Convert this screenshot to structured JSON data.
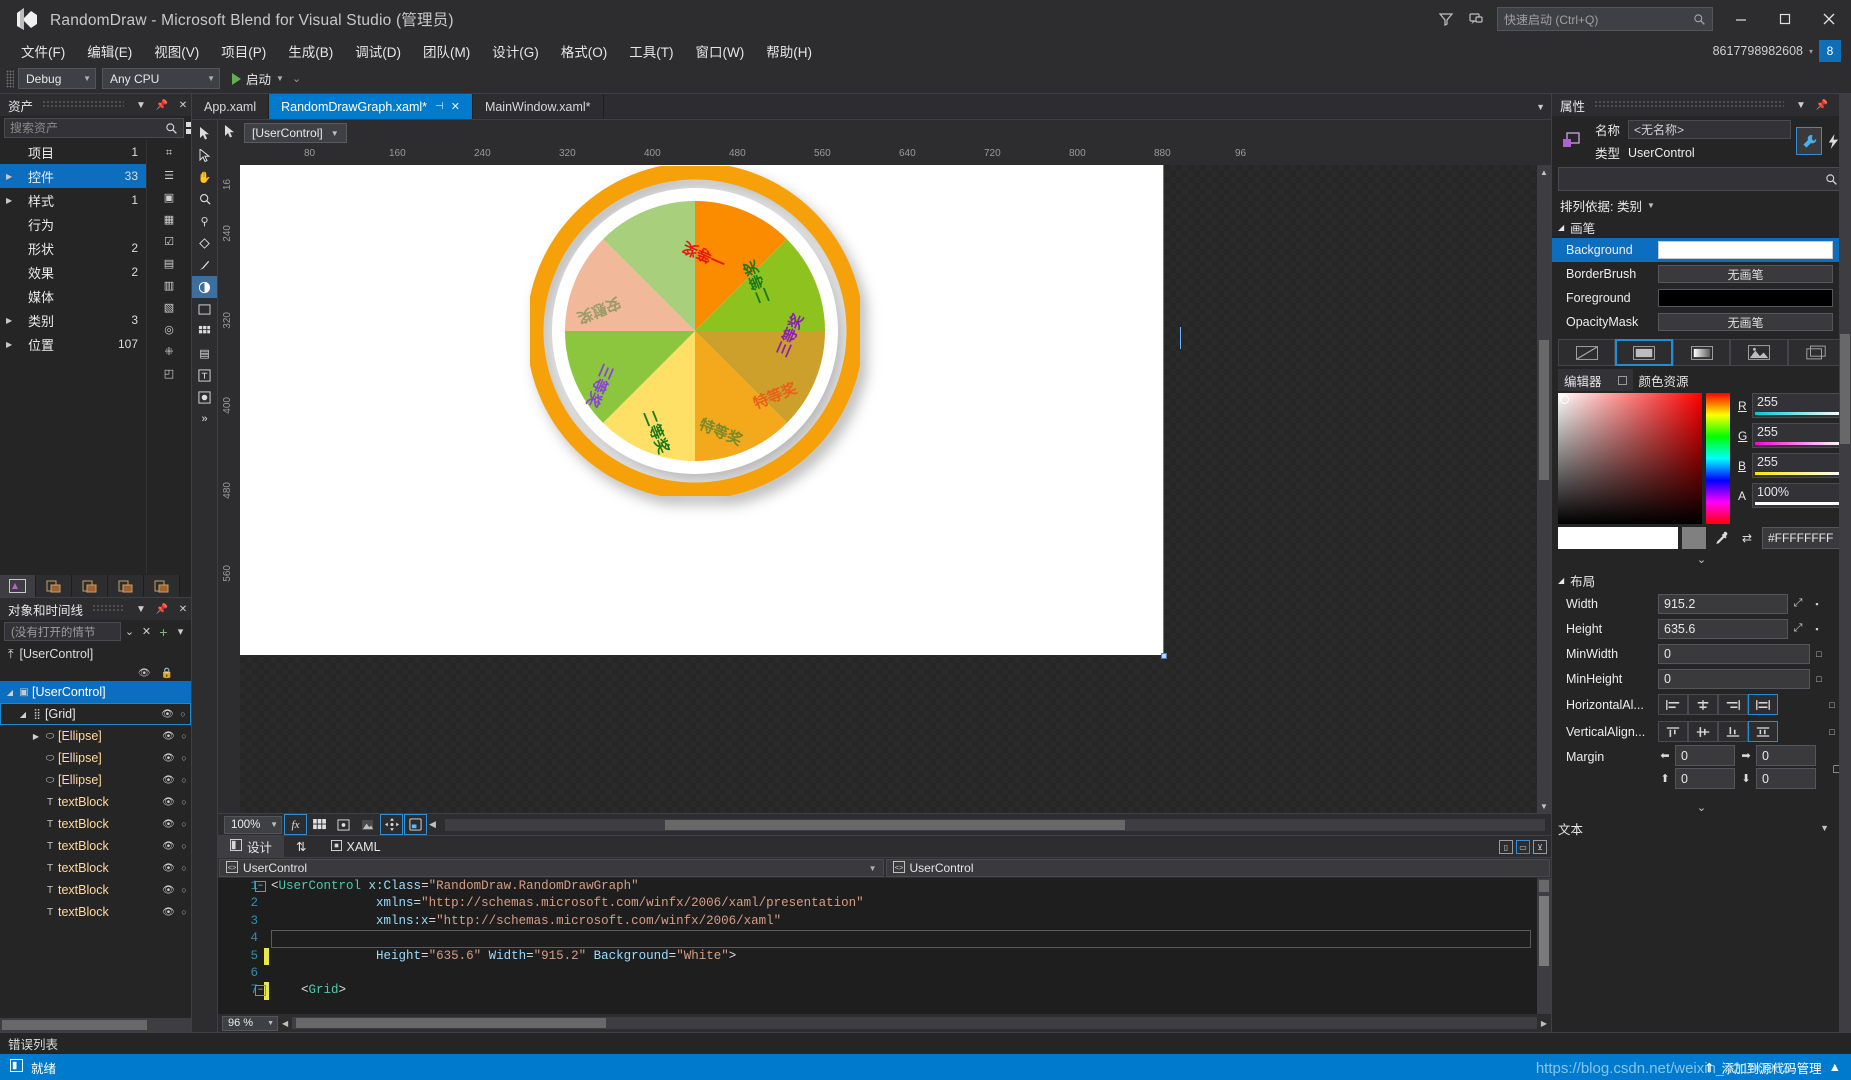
{
  "window": {
    "title": "RandomDraw - Microsoft Blend for Visual Studio (管理员)",
    "logo_icon": "blend-logo-icon",
    "minimize": "minimize-icon",
    "maximize": "maximize-icon",
    "close": "close-icon",
    "feedback_icon": "feedback-icon",
    "notify_icon": "notification-icon"
  },
  "quick_launch": {
    "placeholder": "快速启动 (Ctrl+Q)",
    "icon": "search-icon"
  },
  "account": {
    "name": "8617798982608",
    "badge": "8",
    "caret": "▾"
  },
  "menu": {
    "items": [
      "文件(F)",
      "编辑(E)",
      "视图(V)",
      "项目(P)",
      "生成(B)",
      "调试(D)",
      "团队(M)",
      "设计(G)",
      "格式(O)",
      "工具(T)",
      "窗口(W)",
      "帮助(H)"
    ]
  },
  "toolbar": {
    "config": "Debug",
    "platform": "Any CPU",
    "run_label": "启动",
    "run_icon": "play-icon"
  },
  "assets_panel": {
    "title": "资产",
    "search_placeholder": "搜索资产",
    "search_icon": "search-icon",
    "view_grid_icon": "grid-view-icon",
    "view_list_icon": "list-view-icon",
    "items": [
      {
        "label": "项目",
        "count": "1",
        "expandable": false
      },
      {
        "label": "控件",
        "count": "33",
        "expandable": true,
        "selected": true
      },
      {
        "label": "样式",
        "count": "1",
        "expandable": true
      },
      {
        "label": "行为",
        "count": "",
        "expandable": false
      },
      {
        "label": "形状",
        "count": "2",
        "expandable": false
      },
      {
        "label": "效果",
        "count": "2",
        "expandable": false
      },
      {
        "label": "媒体",
        "count": "",
        "expandable": false
      },
      {
        "label": "类别",
        "count": "3",
        "expandable": true
      },
      {
        "label": "位置",
        "count": "107",
        "expandable": true
      }
    ]
  },
  "timeline_panel": {
    "title": "对象和时间线",
    "storyboard_placeholder": "(没有打开的情节",
    "root_label": "[UserControl]",
    "tree": [
      {
        "label": "[UserControl]",
        "depth": 0,
        "icon": "usercontrol-icon",
        "expanded": true,
        "selected": true
      },
      {
        "label": "[Grid]",
        "depth": 1,
        "icon": "grid-icon",
        "expanded": true,
        "outlined": true
      },
      {
        "label": "[Ellipse]",
        "depth": 2,
        "icon": "ellipse-icon",
        "expanded": false,
        "hasChildren": true
      },
      {
        "label": "[Ellipse]",
        "depth": 2,
        "icon": "ellipse-icon"
      },
      {
        "label": "[Ellipse]",
        "depth": 2,
        "icon": "ellipse-icon"
      },
      {
        "label": "textBlock",
        "depth": 2,
        "icon": "textblock-icon"
      },
      {
        "label": "textBlock",
        "depth": 2,
        "icon": "textblock-icon"
      },
      {
        "label": "textBlock",
        "depth": 2,
        "icon": "textblock-icon"
      },
      {
        "label": "textBlock",
        "depth": 2,
        "icon": "textblock-icon"
      },
      {
        "label": "textBlock",
        "depth": 2,
        "icon": "textblock-icon"
      },
      {
        "label": "textBlock",
        "depth": 2,
        "icon": "textblock-icon"
      }
    ]
  },
  "doc_tabs": [
    {
      "label": "App.xaml",
      "active": false,
      "pinned": false,
      "closable": false
    },
    {
      "label": "RandomDrawGraph.xaml*",
      "active": true,
      "pinned": true,
      "closable": true
    },
    {
      "label": "MainWindow.xaml*",
      "active": false,
      "pinned": false,
      "closable": false
    }
  ],
  "designer": {
    "selected_element": "[UserControl]",
    "artboard_bg": "#ffffff",
    "h_ruler_ticks": [
      "80",
      "160",
      "240",
      "320",
      "400",
      "480",
      "560",
      "640",
      "720",
      "800",
      "880",
      "96"
    ],
    "v_ruler_ticks": [
      "16",
      "240",
      "320",
      "400",
      "480",
      "560"
    ],
    "zoom": "100%",
    "zoom_icons": [
      "effects-icon",
      "grid-snap-icon",
      "snap-gridlines-icon",
      "annotation-icon",
      "snap-to-guides-icon",
      "show-snap-icon"
    ],
    "view_tabs": [
      {
        "label": "设计",
        "icon": "design-view-icon",
        "active": true
      },
      {
        "label": "XAML",
        "icon": "xaml-view-icon",
        "active": false
      }
    ],
    "swap_icon": "swap-views-icon",
    "split_buttons": [
      "vertical-split-icon",
      "horizontal-split-icon",
      "collapse-pane-icon"
    ]
  },
  "wheel": {
    "outer_ring_color": "#f7a10a",
    "inner_white_gap": "#ffffff",
    "segments": [
      {
        "label": "一等奖",
        "fill": "#fb8c00",
        "text": "#e8170c"
      },
      {
        "label": "二等奖",
        "fill": "#8ec31f",
        "text": "#1a7a1a"
      },
      {
        "label": "三等奖",
        "fill": "#cca02a",
        "text": "#8a1fb5"
      },
      {
        "label": "特等奖",
        "fill": "#f4a81c",
        "text": "#e8601c"
      },
      {
        "label": "特等奖",
        "fill": "#ffe066",
        "text": "#7a8a2a"
      },
      {
        "label": "二等奖",
        "fill": "#8cc63f",
        "text": "#1a7a1a"
      },
      {
        "label": "三等奖",
        "fill": "#f2b89a",
        "text": "#8a3fe0"
      },
      {
        "label": "安慰奖",
        "fill": "#a8cf7c",
        "text": "#9a9a6a"
      }
    ]
  },
  "code_editor": {
    "breadcrumb_left": "UserControl",
    "breadcrumb_right": "UserControl",
    "zoom": "96 %",
    "lines": [
      {
        "n": "1",
        "text": "<UserControl x:Class=\"RandomDraw.RandomDrawGraph\"",
        "fold": true
      },
      {
        "n": "2",
        "text": "             xmlns=\"http://schemas.microsoft.com/winfx/2006/xaml/presentation\""
      },
      {
        "n": "3",
        "text": "             xmlns:x=\"http://schemas.microsoft.com/winfx/2006/xaml\""
      },
      {
        "n": "4",
        "text": ""
      },
      {
        "n": "5",
        "text": "             Height=\"635.6\" Width=\"915.2\" Background=\"White\">",
        "changed": true
      },
      {
        "n": "6",
        "text": ""
      },
      {
        "n": "7",
        "text": "    <Grid>",
        "fold": true,
        "changed": true
      }
    ]
  },
  "properties": {
    "title": "属性",
    "name_label": "名称",
    "name_value": "<无名称>",
    "type_label": "类型",
    "type_value": "UserControl",
    "props_icon": "wrench-icon",
    "events_icon": "lightning-icon",
    "search_placeholder": "",
    "search_icon": "search-icon",
    "sort_label": "排列依据: 类别",
    "brush_section": "画笔",
    "brush_rows": [
      {
        "label": "Background",
        "value": "",
        "kind": "white",
        "selected": true
      },
      {
        "label": "BorderBrush",
        "value": "无画笔",
        "kind": "text"
      },
      {
        "label": "Foreground",
        "value": "",
        "kind": "black"
      },
      {
        "label": "OpacityMask",
        "value": "无画笔",
        "kind": "text"
      }
    ],
    "brush_tabs": [
      "no-brush-icon",
      "solid-color-brush-icon",
      "gradient-brush-icon",
      "tile-brush-icon",
      "brush-resources-icon"
    ],
    "brush_tab_selected": 1,
    "editor_tab": "编辑器",
    "resources_tab": "颜色资源",
    "color": {
      "R": "255",
      "G": "255",
      "B": "255",
      "A": "100%",
      "hex": "#FFFFFFFF",
      "eyedropper_icon": "eyedropper-icon",
      "swap_icon": "swap-colors-icon"
    },
    "layout_section": "布局",
    "layout_rows": [
      {
        "label": "Width",
        "value": "915.2"
      },
      {
        "label": "Height",
        "value": "635.6"
      },
      {
        "label": "MinWidth",
        "value": "0"
      },
      {
        "label": "MinHeight",
        "value": "0"
      }
    ],
    "horizontal_align_label": "HorizontalAl...",
    "horizontal_align_selected": 3,
    "vertical_align_label": "VerticalAlign...",
    "vertical_align_selected": 3,
    "margin_label": "Margin",
    "margin": {
      "left": "0",
      "right": "0",
      "top": "0",
      "bottom": "0"
    },
    "text_section": "文本"
  },
  "error_list": {
    "label": "错误列表"
  },
  "status_bar": {
    "ready": "就绪",
    "source_control": "添加到源代码管理",
    "up_icon": "arrow-up-icon",
    "caret_icon": "caret-up-icon",
    "ready_icon": "ready-icon"
  },
  "watermark": "https://blog.csdn.net/weixin_42190963"
}
